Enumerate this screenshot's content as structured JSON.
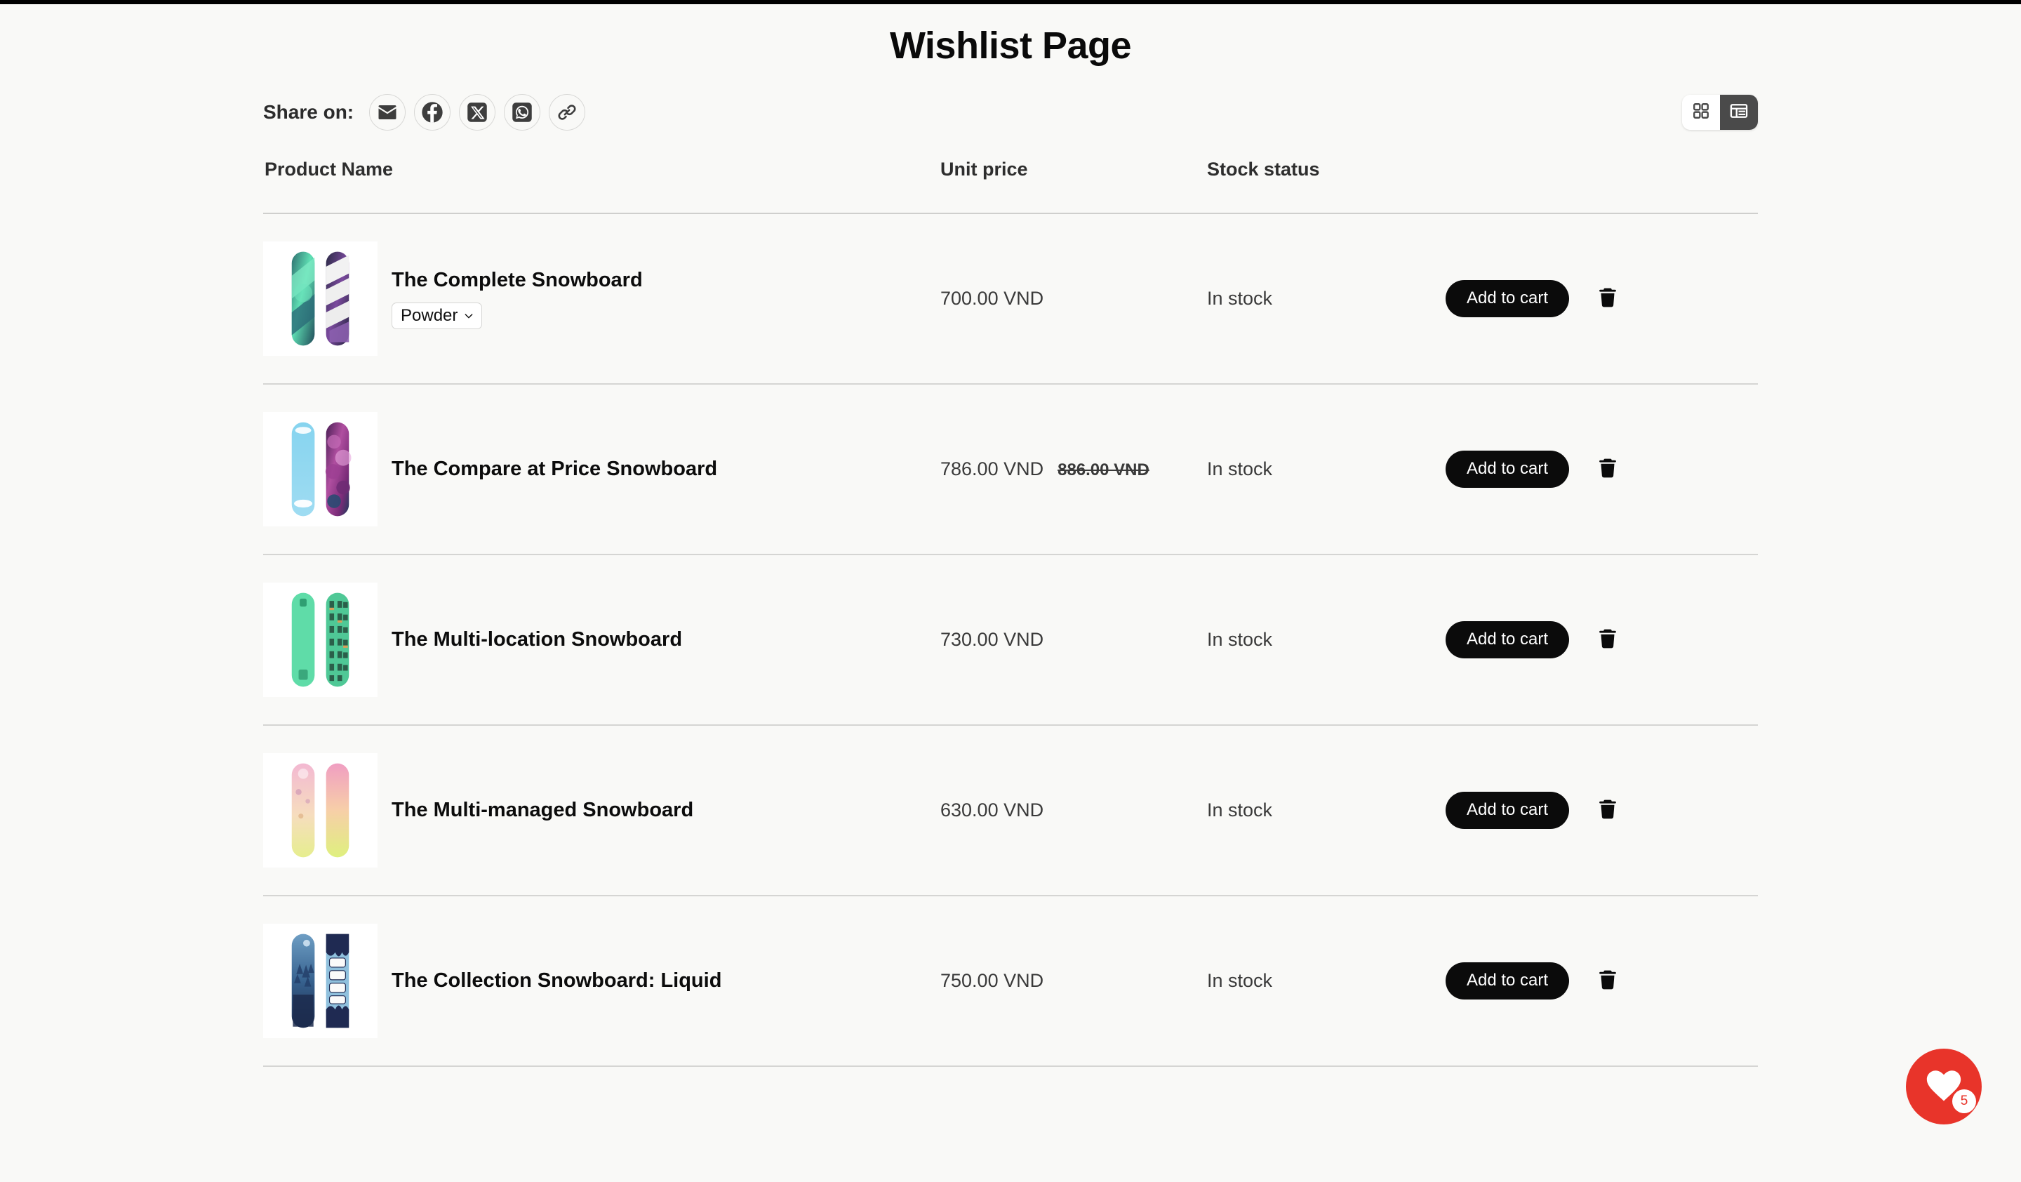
{
  "page": {
    "title": "Wishlist Page",
    "background_color": "#F9F9F7"
  },
  "share": {
    "label": "Share on:",
    "buttons": [
      {
        "name": "email-share-icon",
        "label": "Email"
      },
      {
        "name": "facebook-share-icon",
        "label": "Facebook"
      },
      {
        "name": "x-share-icon",
        "label": "X"
      },
      {
        "name": "whatsapp-share-icon",
        "label": "WhatsApp"
      },
      {
        "name": "copy-link-icon",
        "label": "Copy link"
      }
    ]
  },
  "view_toggle": {
    "grid_label": "Grid view",
    "list_label": "List view",
    "active": "list"
  },
  "table": {
    "headers": {
      "product_name": "Product Name",
      "unit_price": "Unit price",
      "stock_status": "Stock status",
      "actions": ""
    },
    "add_to_cart_label": "Add to cart",
    "remove_label": "Remove",
    "rows": [
      {
        "name": "The Complete Snowboard",
        "variant": "Powder",
        "has_variant": true,
        "price": "700.00 VND",
        "compare_price": "",
        "stock": "In stock",
        "thumb": "complete"
      },
      {
        "name": "The Compare at Price Snowboard",
        "variant": "",
        "has_variant": false,
        "price": "786.00 VND",
        "compare_price": "886.00 VND",
        "stock": "In stock",
        "thumb": "compare"
      },
      {
        "name": "The Multi-location Snowboard",
        "variant": "",
        "has_variant": false,
        "price": "730.00 VND",
        "compare_price": "",
        "stock": "In stock",
        "thumb": "multilocation"
      },
      {
        "name": "The Multi-managed Snowboard",
        "variant": "",
        "has_variant": false,
        "price": "630.00 VND",
        "compare_price": "",
        "stock": "In stock",
        "thumb": "multimanaged"
      },
      {
        "name": "The Collection Snowboard: Liquid",
        "variant": "",
        "has_variant": false,
        "price": "750.00 VND",
        "compare_price": "",
        "stock": "In stock",
        "thumb": "liquid"
      }
    ]
  },
  "floating_wishlist": {
    "count": "5",
    "accent_color": "#E8342A",
    "icon": "heart-icon"
  }
}
